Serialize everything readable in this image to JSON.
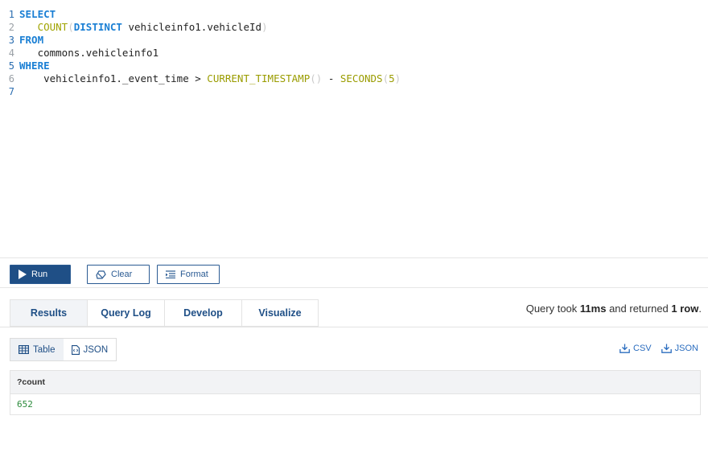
{
  "editor": {
    "lines": [
      {
        "n": "1",
        "tokens": [
          {
            "t": "SELECT",
            "c": "kw"
          }
        ]
      },
      {
        "n": "2",
        "tokens": [
          {
            "t": "   ",
            "c": "plain"
          },
          {
            "t": "COUNT",
            "c": "fn"
          },
          {
            "t": "(",
            "c": "paren"
          },
          {
            "t": "DISTINCT",
            "c": "kw"
          },
          {
            "t": " vehicleinfo1.vehicleId",
            "c": "plain"
          },
          {
            "t": ")",
            "c": "paren"
          }
        ]
      },
      {
        "n": "3",
        "tokens": [
          {
            "t": "FROM",
            "c": "kw"
          }
        ]
      },
      {
        "n": "4",
        "tokens": [
          {
            "t": "   commons.vehicleinfo1",
            "c": "plain"
          }
        ]
      },
      {
        "n": "5",
        "tokens": [
          {
            "t": "WHERE",
            "c": "kw"
          }
        ]
      },
      {
        "n": "6",
        "tokens": [
          {
            "t": "    vehicleinfo1._event_time > ",
            "c": "plain"
          },
          {
            "t": "CURRENT_TIMESTAMP",
            "c": "fn2"
          },
          {
            "t": "()",
            "c": "paren"
          },
          {
            "t": " - ",
            "c": "plain"
          },
          {
            "t": "SECONDS",
            "c": "fn2"
          },
          {
            "t": "(",
            "c": "paren"
          },
          {
            "t": "5",
            "c": "fn2"
          },
          {
            "t": ")",
            "c": "paren"
          }
        ]
      },
      {
        "n": "7",
        "tokens": []
      }
    ]
  },
  "toolbar": {
    "run_label": "Run",
    "clear_label": "Clear",
    "format_label": "Format"
  },
  "tabs": [
    {
      "label": "Results",
      "active": true
    },
    {
      "label": "Query Log",
      "active": false
    },
    {
      "label": "Develop",
      "active": false
    },
    {
      "label": "Visualize",
      "active": false
    }
  ],
  "status": {
    "prefix": "Query took ",
    "time": "11ms",
    "middle": " and returned ",
    "rows": "1 row",
    "suffix": "."
  },
  "view_toggle": {
    "table_label": "Table",
    "json_label": "JSON"
  },
  "downloads": {
    "csv_label": "CSV",
    "json_label": "JSON"
  },
  "results": {
    "columns": [
      "?count"
    ],
    "rows": [
      [
        "652"
      ]
    ]
  },
  "colors": {
    "accent": "#1f4f86",
    "keyword": "#1a7fd4",
    "function": "#a0a300",
    "result_value": "#2a8a3a"
  }
}
